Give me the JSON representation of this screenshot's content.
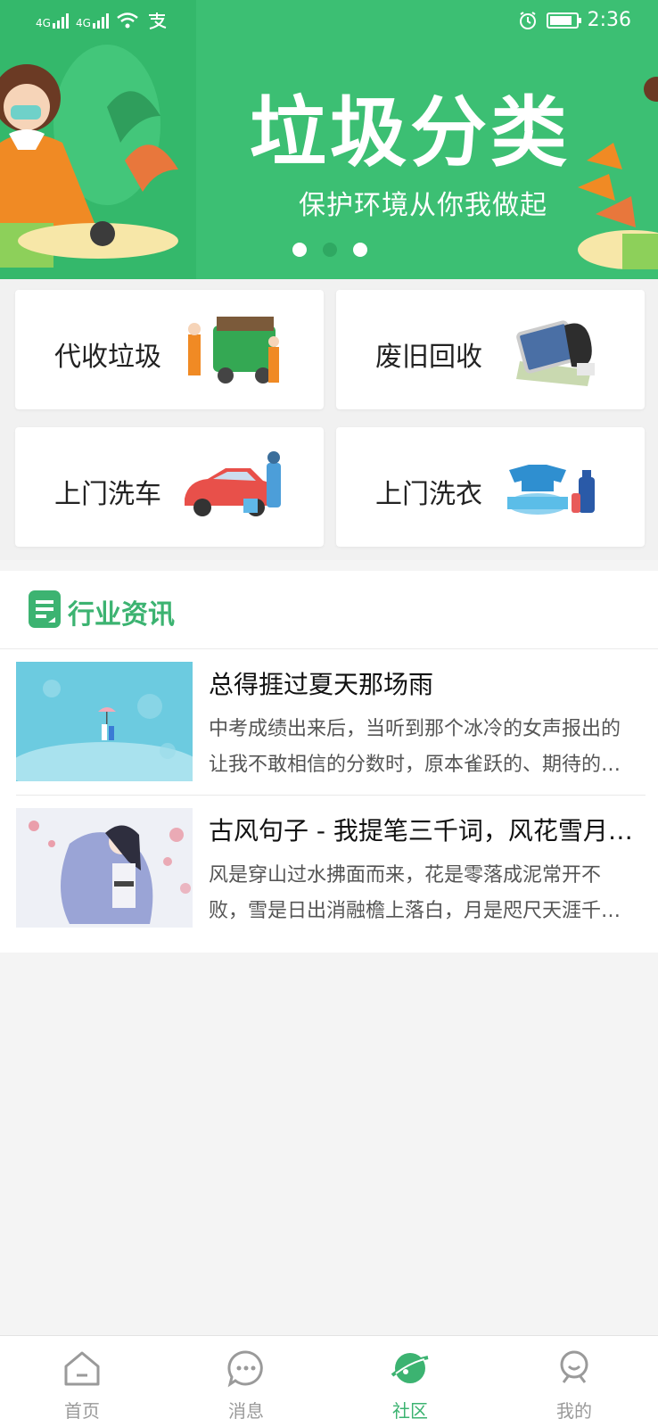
{
  "status_bar": {
    "signal_1": "4G",
    "signal_2": "4G",
    "time": "2:36",
    "battery_level": 0.85
  },
  "banner": {
    "title": "垃圾分类",
    "subtitle": "保护环境从你我做起",
    "carousel_index": 2,
    "carousel_count": 3
  },
  "services": [
    {
      "label": "代收垃圾",
      "icon": "garbage-truck-illustration"
    },
    {
      "label": "废旧回收",
      "icon": "recycle-items-illustration"
    },
    {
      "label": "上门洗车",
      "icon": "car-wash-illustration"
    },
    {
      "label": "上门洗衣",
      "icon": "laundry-illustration"
    }
  ],
  "news": {
    "section_title": "行业资讯",
    "items": [
      {
        "title": "总得捱过夏天那场雨",
        "summary": "中考成绩出来后，当听到那个冰冷的女声报出的让我不敢相信的分数时，原本雀跃的、期待的…"
      },
      {
        "title": "古风句子 - 我提笔三千词，风花雪月…",
        "summary": "风是穿山过水拂面而来，花是零落成泥常开不败，雪是日出消融檐上落白，月是咫尺天涯千…"
      }
    ]
  },
  "bottom_nav": {
    "tabs": [
      {
        "label": "首页",
        "icon": "home-icon"
      },
      {
        "label": "消息",
        "icon": "message-icon"
      },
      {
        "label": "社区",
        "icon": "planet-icon"
      },
      {
        "label": "我的",
        "icon": "profile-icon"
      }
    ],
    "active_tab": 2
  },
  "colors": {
    "brand_green": "#3cbf73",
    "active_tab": "#3cb371",
    "inactive_tab": "#9a9a9a"
  }
}
